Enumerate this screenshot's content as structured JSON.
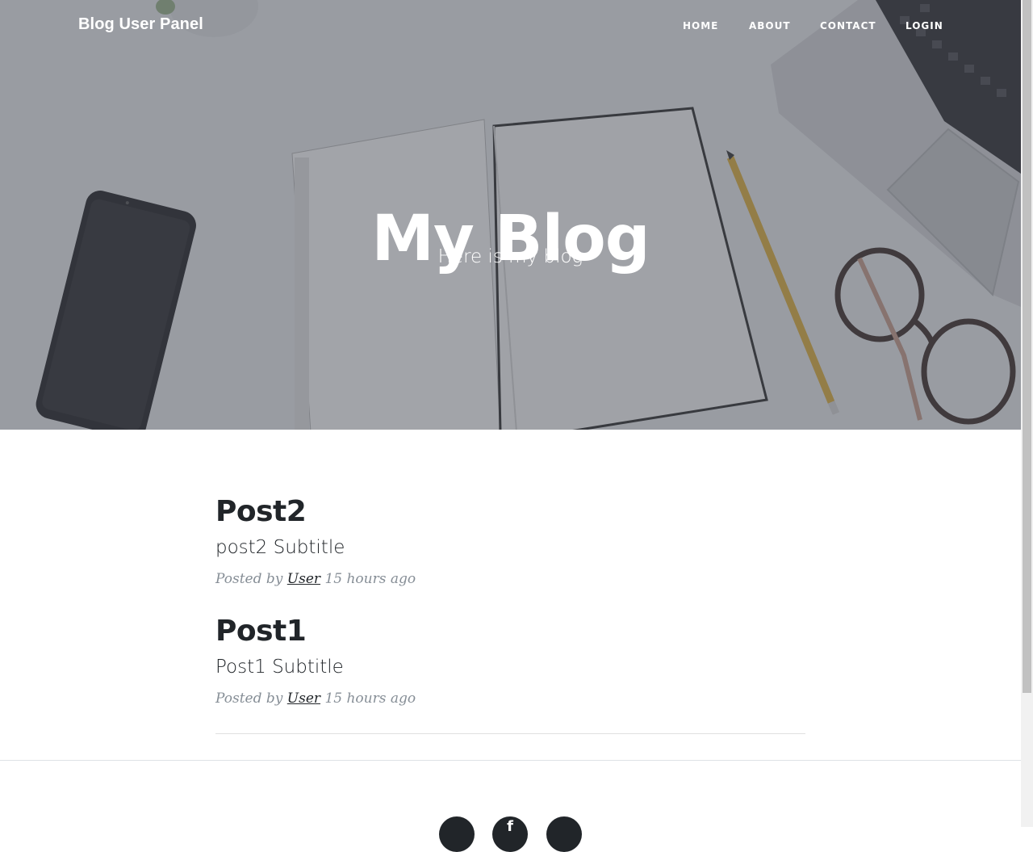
{
  "navbar": {
    "brand": "Blog User Panel",
    "links": [
      "HOME",
      "ABOUT",
      "CONTACT",
      "LOGIN"
    ]
  },
  "hero": {
    "heading": "My Blog",
    "subheading": "Here is my blog"
  },
  "posts": [
    {
      "title": "Post2",
      "subtitle": "post2 Subtitle",
      "meta_prefix": "Posted by",
      "author": "User",
      "time": "15 hours ago"
    },
    {
      "title": "Post1",
      "subtitle": "Post1 Subtitle",
      "meta_prefix": "Posted by",
      "author": "User",
      "time": "15 hours ago"
    }
  ],
  "footer": {
    "social_icons": [
      "twitter-icon",
      "facebook-icon",
      "github-icon"
    ]
  },
  "colors": {
    "hero_overlay": "#464a54",
    "text_dark": "#212529",
    "meta_gray": "#868e96"
  }
}
